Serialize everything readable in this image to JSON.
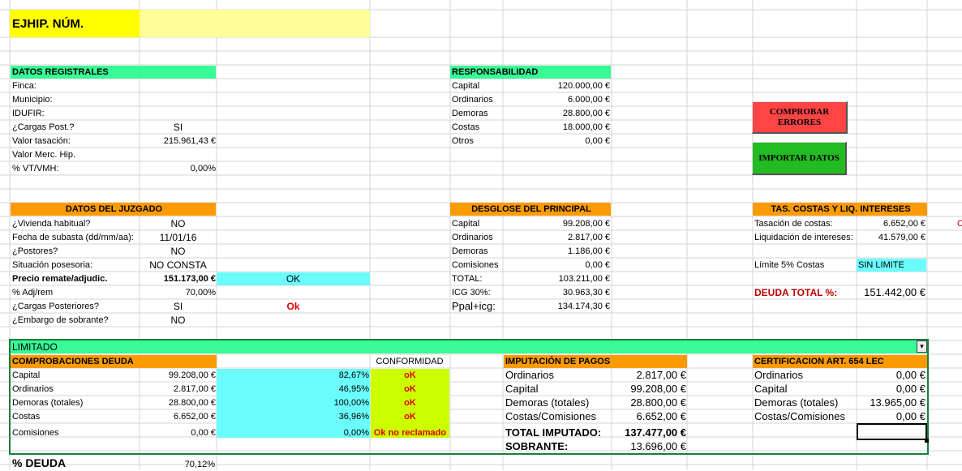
{
  "title": {
    "label": "EJHIP. NÚM."
  },
  "registrales": {
    "header": "DATOS REGISTRALES",
    "rows": [
      {
        "label": "Finca:",
        "value": ""
      },
      {
        "label": "Municipio:",
        "value": ""
      },
      {
        "label": "IDUFIR:",
        "value": ""
      },
      {
        "label": "¿Cargas Post.?",
        "value": "SI"
      },
      {
        "label": "Valor tasación:",
        "value": "215.961,43 €"
      },
      {
        "label": "Valor Merc. Hip.",
        "value": ""
      },
      {
        "label": "% VT/VMH:",
        "value": "0,00%"
      }
    ]
  },
  "responsabilidad": {
    "header": "RESPONSABILIDAD",
    "rows": [
      {
        "label": "Capital",
        "value": "120.000,00 €"
      },
      {
        "label": "Ordinarios",
        "value": "6.000,00 €"
      },
      {
        "label": "Demoras",
        "value": "28.800,00 €"
      },
      {
        "label": "Costas",
        "value": "18.000,00 €"
      },
      {
        "label": "Otros",
        "value": "0,00 €"
      }
    ]
  },
  "buttons": {
    "comprobar": "COMPROBAR ERRORES",
    "importar": "IMPORTAR DATOS"
  },
  "juzgado": {
    "header": "DATOS DEL JUZGADO",
    "rows": [
      {
        "label": "¿Vivienda habitual?",
        "value": "NO",
        "check": ""
      },
      {
        "label": "Fecha de subasta (dd/mm/aa):",
        "value": "11/01/16",
        "check": ""
      },
      {
        "label": "¿Postores?",
        "value": "NO",
        "check": ""
      },
      {
        "label": "Situación posesoria:",
        "value": "NO CONSTA",
        "check": ""
      },
      {
        "label": "Precio remate/adjudic.",
        "value": "151.173,00 €",
        "check": "OK"
      },
      {
        "label": "% Adj/rem",
        "value": "70,00%",
        "check": ""
      },
      {
        "label": "¿Cargas Posteriores?",
        "value": "SI",
        "check": "Ok"
      },
      {
        "label": "¿Embargo de sobrante?",
        "value": "NO",
        "check": ""
      }
    ]
  },
  "desglose": {
    "header": "DESGLOSE DEL PRINCIPAL",
    "rows": [
      {
        "label": "Capital",
        "value": "99.208,00 €"
      },
      {
        "label": "Ordinarios",
        "value": "2.817,00 €"
      },
      {
        "label": "Demoras",
        "value": "1.186,00 €"
      },
      {
        "label": "Comisiones",
        "value": "0,00 €"
      },
      {
        "label": "TOTAL:",
        "value": "103.211,00 €"
      },
      {
        "label": "ICG 30%:",
        "value": "30.963,30 €"
      },
      {
        "label": "Ppal+icg:",
        "value": "134.174,30 €"
      }
    ]
  },
  "tasacion": {
    "header": "TAS. COSTAS Y LIQ. INTERESES",
    "rows": [
      {
        "label": "Tasación de costas:",
        "value": "6.652,00 €"
      },
      {
        "label": "Liquidación de intereses:",
        "value": "41.579,00 €"
      }
    ],
    "limite_label": "Límite 5% Costas",
    "limite_value": "SIN LIMITE",
    "deuda_label": "DEUDA TOTAL %:",
    "deuda_value": "151.442,00 €",
    "edge_char": "C"
  },
  "limitado": {
    "label": "LIMITADO",
    "dropdown_arrow": "▾"
  },
  "comprobaciones": {
    "header": "COMPROBACIONES DEUDA",
    "conformidad_header": "CONFORMIDAD",
    "rows": [
      {
        "label": "Capital",
        "value": "99.208,00 €",
        "pct": "82,67%",
        "status": "oK"
      },
      {
        "label": "Ordinarios",
        "value": "2.817,00 €",
        "pct": "46,95%",
        "status": "oK"
      },
      {
        "label": "Demoras (totales)",
        "value": "28.800,00 €",
        "pct": "100,00%",
        "status": "oK"
      },
      {
        "label": "Costas",
        "value": "6.652,00 €",
        "pct": "36,96%",
        "status": "oK"
      },
      {
        "label": "Comisiones",
        "value": "0,00 €",
        "pct": "0,00%",
        "status": "Ok no reclamado"
      }
    ]
  },
  "imputacion": {
    "header": "IMPUTACIÓN DE PAGOS",
    "rows": [
      {
        "label": "Ordinarios",
        "value": "2.817,00 €"
      },
      {
        "label": "Capital",
        "value": "99.208,00 €"
      },
      {
        "label": "Demoras (totales)",
        "value": "28.800,00 €"
      },
      {
        "label": "Costas/Comisiones",
        "value": "6.652,00 €"
      }
    ],
    "total_label": "TOTAL IMPUTADO:",
    "total_value": "137.477,00 €",
    "sobrante_label": "SOBRANTE:",
    "sobrante_value": "13.696,00 €"
  },
  "certificacion": {
    "header": "CERTIFICACION ART. 654 LEC",
    "rows": [
      {
        "label": "Ordinarios",
        "value": "0,00 €"
      },
      {
        "label": "Capital",
        "value": "0,00 €"
      },
      {
        "label": "Demoras (totales)",
        "value": "13.965,00 €"
      },
      {
        "label": "Costas/Comisiones",
        "value": "0,00 €"
      }
    ]
  },
  "footer": {
    "label": "% DEUDA",
    "value": "70,12%"
  },
  "colors": {
    "green": "#38fa97",
    "orange": "#fb9a02",
    "cyan": "#6bfcfc",
    "lime": "#ccff00",
    "yellow": "#ffff00",
    "light_yellow": "#ffff99",
    "button_red": "#ff4444",
    "button_green": "#22bb22"
  }
}
